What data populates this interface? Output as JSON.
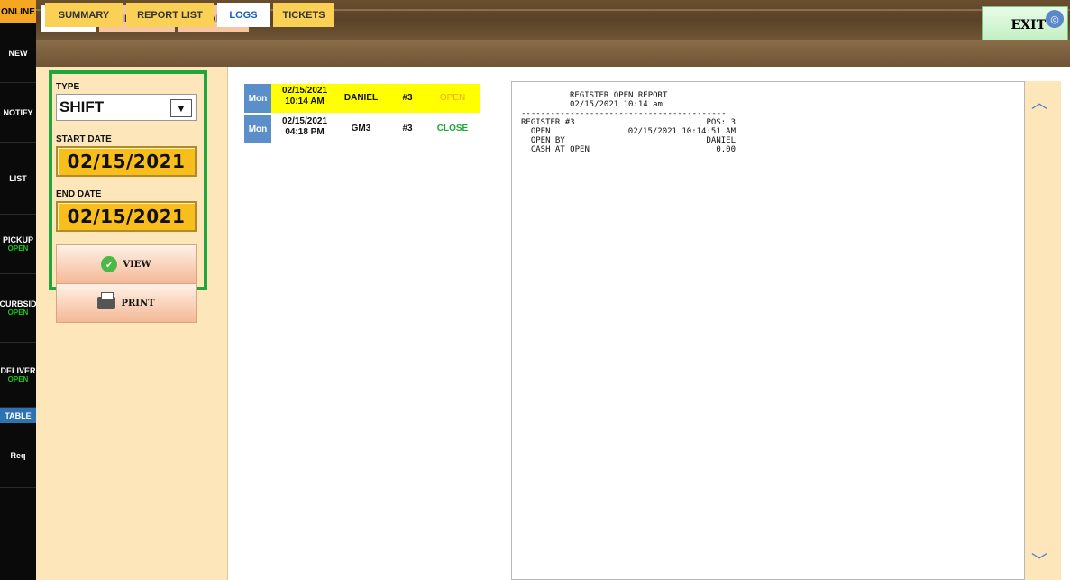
{
  "sidebar": {
    "online": "ONLINE",
    "items": [
      {
        "label": "NEW",
        "sub": ""
      },
      {
        "label": "NOTIFY",
        "sub": ""
      },
      {
        "label": "LIST",
        "sub": ""
      },
      {
        "label": "PICKUP",
        "sub": "OPEN"
      },
      {
        "label": "CURBSID",
        "sub": "OPEN"
      },
      {
        "label": "DELIVER",
        "sub": "OPEN"
      },
      {
        "label": "Req",
        "sub": ""
      }
    ],
    "table_label": "TABLE"
  },
  "top_tabs": [
    "SALES",
    "EMPLOYEE",
    "PAYABLE"
  ],
  "exit_label": "EXIT",
  "sub_tabs": [
    "SUMMARY",
    "REPORT LIST",
    "LOGS",
    "TICKETS"
  ],
  "filters": {
    "type_label": "TYPE",
    "type_value": "SHIFT",
    "start_label": "START DATE",
    "start_value": "02/15/2021",
    "end_label": "END DATE",
    "end_value": "02/15/2021",
    "view_label": "VIEW",
    "print_label": "PRINT"
  },
  "logs": [
    {
      "day": "Mon",
      "date": "02/15/2021",
      "time": "10:14 AM",
      "who": "DANIEL",
      "reg": "#3",
      "status": "OPEN",
      "status_color": "#f5a623",
      "row_bg": "#ffff00"
    },
    {
      "day": "Mon",
      "date": "02/15/2021",
      "time": "04:18 PM",
      "who": "GM3",
      "reg": "#3",
      "status": "CLOSE",
      "status_color": "#1ea83c",
      "row_bg": "#ffffff"
    }
  ],
  "report": {
    "title": "REGISTER OPEN REPORT",
    "subtitle": "02/15/2021 10:14 am",
    "divider": "------------------------------------------",
    "rows": [
      {
        "label": "REGISTER #3",
        "value": "POS: 3"
      },
      {
        "label": "  OPEN",
        "value": "02/15/2021 10:14:51 AM"
      },
      {
        "label": "  OPEN BY",
        "value": "DANIEL"
      },
      {
        "label": "  CASH AT OPEN",
        "value": "0.00"
      }
    ]
  }
}
